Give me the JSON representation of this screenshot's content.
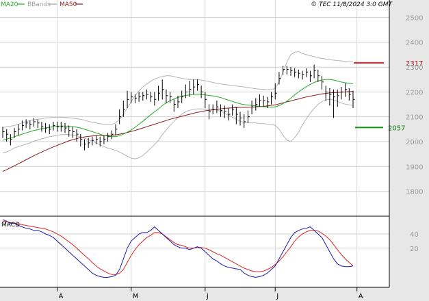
{
  "chart_data": {
    "type": "line",
    "ohlc_style": "bar",
    "watermark": "© TEC 11/8/2024 3:0 GMT",
    "legend": [
      {
        "label": "MA20",
        "color": "#22aa22",
        "muted": false
      },
      {
        "label": "BBands",
        "color": "#a0a0a0",
        "muted": true
      },
      {
        "label": "MA50",
        "color": "#8b1a1a",
        "muted": false
      }
    ],
    "price_axis": {
      "ticks": [
        1800,
        1900,
        2000,
        2100,
        2200,
        2300,
        2400,
        2500
      ],
      "ylim": [
        1700,
        2570
      ]
    },
    "levels": [
      {
        "label": "2317",
        "value": 2317,
        "color": "#dd2222"
      },
      {
        "label": "2057",
        "value": 2057,
        "color": "#119911"
      }
    ],
    "month_labels": [
      {
        "label": "A",
        "index": 14
      },
      {
        "label": "M",
        "index": 33
      },
      {
        "label": "J",
        "index": 52
      },
      {
        "label": "J",
        "index": 70
      },
      {
        "label": "A",
        "index": 91
      }
    ],
    "closes": [
      2040,
      2030,
      2010,
      2040,
      2050,
      2065,
      2075,
      2070,
      2080,
      2075,
      2060,
      2055,
      2050,
      2065,
      2060,
      2060,
      2055,
      2045,
      2040,
      2030,
      2010,
      1990,
      1995,
      2005,
      2010,
      2000,
      2010,
      2020,
      2030,
      2050,
      2100,
      2130,
      2170,
      2180,
      2175,
      2180,
      2185,
      2190,
      2180,
      2170,
      2195,
      2210,
      2185,
      2180,
      2150,
      2160,
      2180,
      2200,
      2210,
      2220,
      2230,
      2200,
      2170,
      2120,
      2130,
      2140,
      2125,
      2120,
      2110,
      2130,
      2110,
      2095,
      2080,
      2100,
      2140,
      2150,
      2165,
      2165,
      2160,
      2180,
      2195,
      2255,
      2290,
      2290,
      2285,
      2280,
      2275,
      2270,
      2280,
      2265,
      2285,
      2265,
      2240,
      2200,
      2190,
      2180,
      2185,
      2200,
      2210,
      2190,
      2170
    ],
    "highs": [
      2060,
      2050,
      2030,
      2055,
      2070,
      2085,
      2090,
      2085,
      2095,
      2090,
      2080,
      2075,
      2070,
      2080,
      2080,
      2080,
      2075,
      2065,
      2060,
      2050,
      2030,
      2010,
      2015,
      2020,
      2025,
      2020,
      2025,
      2035,
      2045,
      2070,
      2130,
      2165,
      2205,
      2200,
      2190,
      2200,
      2200,
      2210,
      2200,
      2200,
      2225,
      2250,
      2210,
      2200,
      2170,
      2185,
      2205,
      2230,
      2245,
      2250,
      2250,
      2225,
      2200,
      2150,
      2150,
      2165,
      2150,
      2145,
      2135,
      2150,
      2140,
      2120,
      2110,
      2125,
      2165,
      2175,
      2190,
      2185,
      2180,
      2200,
      2235,
      2280,
      2305,
      2305,
      2300,
      2295,
      2290,
      2285,
      2295,
      2285,
      2310,
      2290,
      2265,
      2225,
      2215,
      2210,
      2210,
      2220,
      2235,
      2215,
      2205
    ],
    "lows": [
      2015,
      2000,
      1985,
      2015,
      2025,
      2045,
      2055,
      2050,
      2060,
      2055,
      2040,
      2035,
      2030,
      2045,
      2040,
      2040,
      2035,
      2020,
      2015,
      2000,
      1980,
      1965,
      1975,
      1985,
      1990,
      1980,
      1990,
      2000,
      2010,
      2025,
      2070,
      2100,
      2135,
      2155,
      2155,
      2160,
      2165,
      2170,
      2160,
      2145,
      2165,
      2170,
      2155,
      2155,
      2120,
      2135,
      2155,
      2175,
      2180,
      2190,
      2205,
      2175,
      2135,
      2090,
      2110,
      2115,
      2100,
      2095,
      2085,
      2105,
      2070,
      2065,
      2055,
      2075,
      2110,
      2125,
      2140,
      2140,
      2135,
      2150,
      2170,
      2230,
      2270,
      2270,
      2265,
      2260,
      2255,
      2250,
      2260,
      2240,
      2255,
      2240,
      2210,
      2165,
      2145,
      2095,
      2140,
      2170,
      2180,
      2165,
      2135
    ],
    "ma20": [
      2005,
      2010,
      2015,
      2020,
      2025,
      2030,
      2035,
      2040,
      2045,
      2048,
      2052,
      2055,
      2058,
      2060,
      2062,
      2063,
      2063,
      2062,
      2060,
      2058,
      2055,
      2050,
      2045,
      2040,
      2035,
      2030,
      2025,
      2022,
      2020,
      2020,
      2024,
      2030,
      2038,
      2047,
      2058,
      2070,
      2082,
      2095,
      2108,
      2120,
      2132,
      2145,
      2156,
      2165,
      2172,
      2178,
      2183,
      2186,
      2188,
      2190,
      2191,
      2190,
      2188,
      2186,
      2184,
      2181,
      2177,
      2172,
      2167,
      2162,
      2157,
      2152,
      2149,
      2147,
      2146,
      2144,
      2142,
      2141,
      2140,
      2139,
      2140,
      2145,
      2153,
      2163,
      2175,
      2188,
      2200,
      2211,
      2221,
      2230,
      2238,
      2244,
      2248,
      2250,
      2250,
      2248,
      2244,
      2240,
      2237,
      2235,
      2233
    ],
    "ma50": [
      1880,
      1887,
      1895,
      1903,
      1911,
      1919,
      1927,
      1935,
      1943,
      1951,
      1958,
      1965,
      1972,
      1979,
      1985,
      1991,
      1997,
      2003,
      2008,
      2012,
      2016,
      2019,
      2021,
      2023,
      2024,
      2025,
      2025,
      2025,
      2026,
      2027,
      2030,
      2033,
      2037,
      2041,
      2045,
      2050,
      2055,
      2060,
      2065,
      2070,
      2075,
      2080,
      2085,
      2090,
      2094,
      2098,
      2102,
      2106,
      2110,
      2114,
      2118,
      2121,
      2124,
      2126,
      2128,
      2130,
      2132,
      2134,
      2135,
      2136,
      2137,
      2138,
      2138,
      2138,
      2139,
      2140,
      2141,
      2142,
      2144,
      2146,
      2148,
      2152,
      2156,
      2160,
      2164,
      2168,
      2172,
      2176,
      2180,
      2183,
      2186,
      2189,
      2192,
      2194,
      2196,
      2197,
      2198,
      2199,
      2200,
      2201,
      2202
    ],
    "bb_upper": [
      2055,
      2060,
      2062,
      2065,
      2070,
      2075,
      2080,
      2085,
      2088,
      2090,
      2092,
      2095,
      2096,
      2098,
      2098,
      2098,
      2097,
      2096,
      2094,
      2092,
      2090,
      2086,
      2082,
      2078,
      2075,
      2072,
      2070,
      2070,
      2070,
      2075,
      2090,
      2110,
      2135,
      2160,
      2185,
      2205,
      2220,
      2232,
      2243,
      2252,
      2258,
      2262,
      2265,
      2265,
      2262,
      2258,
      2255,
      2252,
      2250,
      2250,
      2250,
      2248,
      2245,
      2242,
      2238,
      2235,
      2232,
      2230,
      2228,
      2226,
      2224,
      2222,
      2220,
      2218,
      2215,
      2213,
      2211,
      2210,
      2209,
      2210,
      2214,
      2240,
      2280,
      2320,
      2350,
      2360,
      2362,
      2355,
      2350,
      2346,
      2342,
      2338,
      2335,
      2332,
      2330,
      2328,
      2326,
      2325,
      2323,
      2322,
      2320
    ],
    "bb_lower": [
      1955,
      1958,
      1966,
      1975,
      1980,
      1985,
      1990,
      1995,
      2002,
      2006,
      2012,
      2015,
      2020,
      2022,
      2026,
      2028,
      2029,
      2028,
      2026,
      2024,
      2020,
      2014,
      2008,
      2002,
      1995,
      1988,
      1980,
      1974,
      1970,
      1965,
      1958,
      1950,
      1941,
      1934,
      1931,
      1935,
      1944,
      1958,
      1973,
      1988,
      2006,
      2028,
      2047,
      2065,
      2082,
      2098,
      2111,
      2120,
      2126,
      2130,
      2132,
      2132,
      2131,
      2130,
      2130,
      2127,
      2122,
      2114,
      2106,
      2098,
      2090,
      2082,
      2078,
      2076,
      2077,
      2075,
      2073,
      2072,
      2071,
      2068,
      2066,
      2050,
      2026,
      2006,
      2000,
      2016,
      2038,
      2067,
      2092,
      2114,
      2134,
      2150,
      2161,
      2168,
      2170,
      2168,
      2162,
      2155,
      2151,
      2148,
      2146
    ],
    "macd_panel": {
      "label": "MACD",
      "ticks": [
        {
          "label": "40",
          "value": 40
        },
        {
          "label": "20",
          "value": 20
        }
      ],
      "ylim": [
        -35,
        65
      ],
      "macd_color": "#1a1aaa",
      "signal_color": "#dd2222",
      "macd": [
        60,
        58,
        55,
        55,
        52,
        50,
        48,
        47,
        45,
        45,
        43,
        40,
        38,
        35,
        30,
        25,
        20,
        15,
        10,
        5,
        0,
        -5,
        -10,
        -15,
        -18,
        -20,
        -21,
        -21,
        -20,
        -18,
        -10,
        5,
        20,
        30,
        35,
        40,
        42,
        42,
        45,
        50,
        45,
        40,
        35,
        30,
        25,
        22,
        20,
        20,
        18,
        20,
        22,
        20,
        15,
        10,
        5,
        2,
        -2,
        -5,
        -7,
        -8,
        -9,
        -10,
        -15,
        -18,
        -20,
        -21,
        -20,
        -18,
        -15,
        -10,
        -5,
        5,
        15,
        25,
        35,
        42,
        45,
        47,
        48,
        50,
        45,
        40,
        35,
        25,
        15,
        5,
        -2,
        -5,
        -6,
        -6,
        -5
      ],
      "signal": [
        58,
        57,
        56,
        55,
        54,
        53,
        52,
        51,
        50,
        49,
        48,
        47,
        45,
        43,
        40,
        37,
        33,
        29,
        25,
        20,
        15,
        10,
        5,
        0,
        -5,
        -9,
        -12,
        -15,
        -17,
        -17,
        -15,
        -10,
        0,
        10,
        18,
        25,
        30,
        35,
        38,
        42,
        42,
        40,
        36,
        32,
        28,
        25,
        24,
        22,
        20,
        20,
        21,
        21,
        20,
        18,
        15,
        12,
        10,
        7,
        4,
        1,
        -2,
        -5,
        -8,
        -10,
        -12,
        -13,
        -13,
        -12,
        -10,
        -7,
        -3,
        2,
        8,
        15,
        22,
        30,
        36,
        40,
        43,
        45,
        45,
        44,
        41,
        37,
        32,
        25,
        18,
        11,
        5,
        0,
        -5
      ]
    },
    "current": {
      "label": "2317"
    }
  }
}
